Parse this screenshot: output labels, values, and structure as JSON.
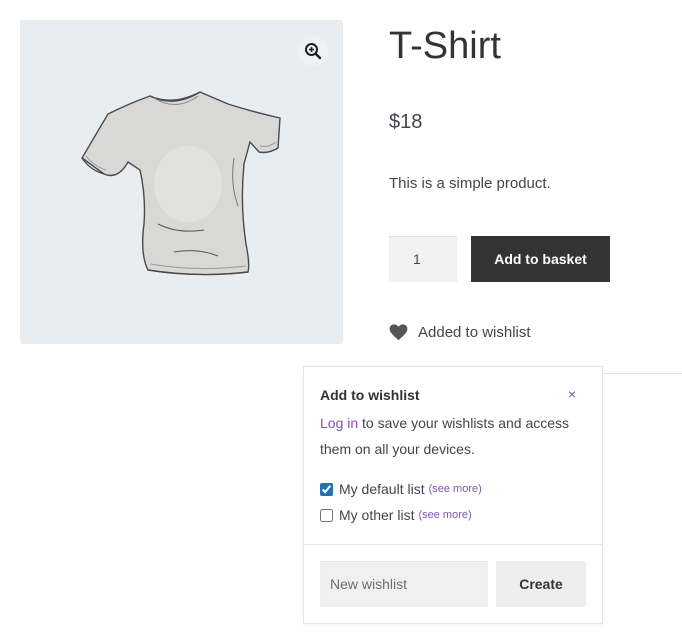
{
  "product": {
    "title": "T-Shirt",
    "price": "$18",
    "description": "This is a simple product.",
    "quantity": "1",
    "add_to_basket_label": "Add to basket",
    "wishlist_status": "Added to wishlist",
    "image_icon": "tshirt-image",
    "zoom_icon": "magnifier-plus-icon"
  },
  "wishlist_popup": {
    "title": "Add to wishlist",
    "close_label": "×",
    "login_link": "Log in",
    "login_text": " to save your wishlists and access them on all your devices.",
    "lists": [
      {
        "label": "My default list",
        "checked": true,
        "see_more": "(see more)"
      },
      {
        "label": "My other list",
        "checked": false,
        "see_more": "(see more)"
      }
    ],
    "new_wishlist_placeholder": "New wishlist",
    "create_label": "Create"
  },
  "colors": {
    "accent": "#7f54b3",
    "button_dark": "#333333",
    "gallery_bg": "#e8edf1"
  }
}
